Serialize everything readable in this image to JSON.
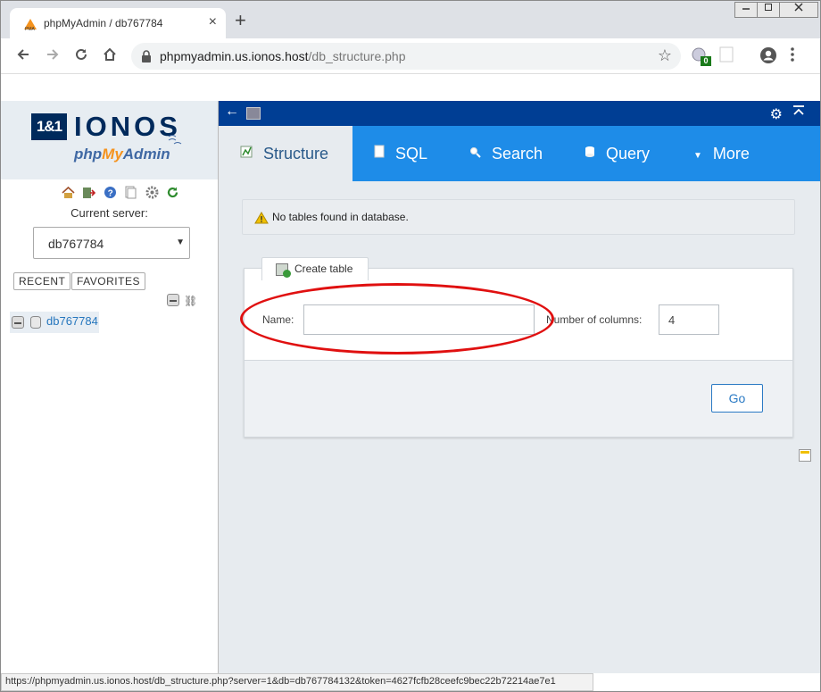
{
  "browser": {
    "tab_title": "phpMyAdmin / db767784",
    "tab_close": "×",
    "new_tab": "+",
    "url_host": "phpmyadmin.us.ionos.host",
    "url_path": "/db_structure.php",
    "extension_badge": "0",
    "status_url": "https://phpmyadmin.us.ionos.host/db_structure.php?server=1&db=db767784132&token=4627fcfb28ceefc9bec22b72214ae7e1"
  },
  "logo": {
    "brand_number": "1&1",
    "brand_name": "IONOS",
    "product_prefix": "php",
    "product_my": "My",
    "product_suffix": "Admin"
  },
  "nav": {
    "current_server_label": "Current server:",
    "server_value": "db767784",
    "recent_label": "RECENT",
    "favorites_label": "FAVORITES",
    "database_name": "db767784"
  },
  "menu": {
    "structure": "Structure",
    "sql": "SQL",
    "search": "Search",
    "query": "Query",
    "more": "More"
  },
  "notice": {
    "text": "No tables found in database."
  },
  "create_table": {
    "legend": "Create table",
    "name_label": "Name:",
    "name_value": "",
    "columns_label": "Number of columns:",
    "columns_value": "4",
    "go_label": "Go"
  },
  "colors": {
    "top_bar": "#003e94",
    "menu_bar": "#1e8ce8",
    "annotation": "#e01010"
  }
}
